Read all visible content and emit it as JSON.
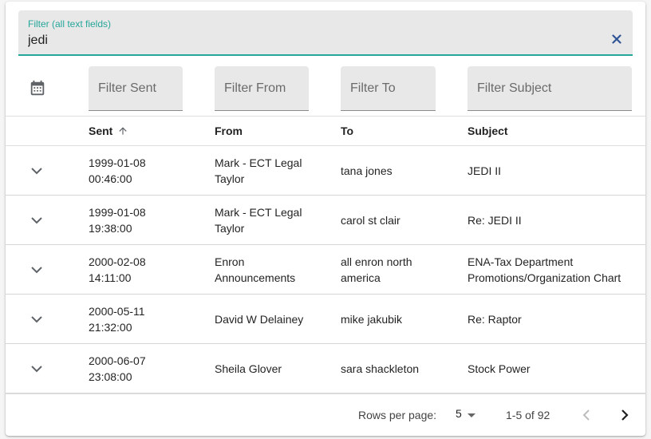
{
  "global_filter": {
    "label": "Filter (all text fields)",
    "value": "jedi",
    "accent_color": "#26a69a"
  },
  "column_filters": {
    "sent_placeholder": "Filter Sent",
    "from_placeholder": "Filter From",
    "to_placeholder": "Filter To",
    "subject_placeholder": "Filter Subject",
    "date_picker_icon": "calendar-icon"
  },
  "columns": {
    "sent": "Sent",
    "from": "From",
    "to": "To",
    "subject": "Subject",
    "sort_icon": "arrow-up-icon"
  },
  "rows": [
    {
      "sent_date": "1999-01-08",
      "sent_time": "00:46:00",
      "from_line1": "Mark - ECT Legal",
      "from_line2": "Taylor",
      "to_line1": "tana jones",
      "to_line2": "",
      "subject_line1": "JEDI II",
      "subject_line2": ""
    },
    {
      "sent_date": "1999-01-08",
      "sent_time": "19:38:00",
      "from_line1": "Mark - ECT Legal",
      "from_line2": "Taylor",
      "to_line1": "carol st clair",
      "to_line2": "",
      "subject_line1": "Re: JEDI II",
      "subject_line2": ""
    },
    {
      "sent_date": "2000-02-08",
      "sent_time": "14:11:00",
      "from_line1": "Enron",
      "from_line2": "Announcements",
      "to_line1": "all enron north",
      "to_line2": "america",
      "subject_line1": "ENA-Tax Department",
      "subject_line2": "Promotions/Organization Chart"
    },
    {
      "sent_date": "2000-05-11",
      "sent_time": "21:32:00",
      "from_line1": "David W Delainey",
      "from_line2": "",
      "to_line1": "mike jakubik",
      "to_line2": "",
      "subject_line1": "Re: Raptor",
      "subject_line2": ""
    },
    {
      "sent_date": "2000-06-07",
      "sent_time": "23:08:00",
      "from_line1": "Sheila Glover",
      "from_line2": "",
      "to_line1": "sara shackleton",
      "to_line2": "",
      "subject_line1": "Stock Power",
      "subject_line2": ""
    }
  ],
  "pagination": {
    "rows_per_page_label": "Rows per page:",
    "rows_per_page_value": "5",
    "range_text": "1-5 of 92",
    "prev_icon": "chevron-left-icon",
    "next_icon": "chevron-right-icon"
  }
}
